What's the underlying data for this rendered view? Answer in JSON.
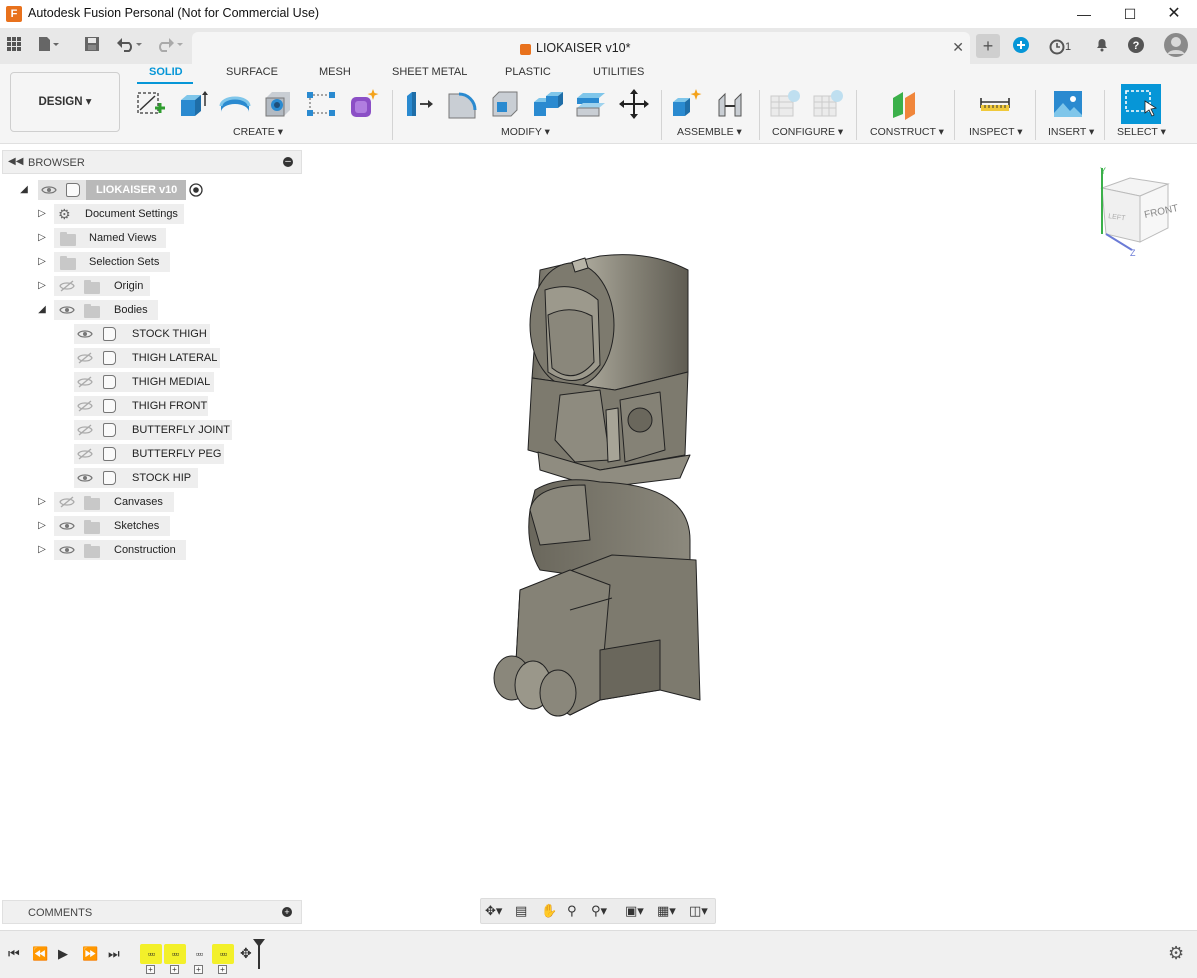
{
  "window": {
    "title": "Autodesk Fusion Personal (Not for Commercial Use)",
    "app_icon_letter": "F",
    "controls": [
      "minimize-icon",
      "maximize-icon",
      "close-icon"
    ]
  },
  "tabbar": {
    "document_tab": "LIOKAISER v10*",
    "job_count": "1"
  },
  "ribbon": {
    "workspace": "DESIGN",
    "tabs": [
      "SOLID",
      "SURFACE",
      "MESH",
      "SHEET METAL",
      "PLASTIC",
      "UTILITIES"
    ],
    "active_tab": "SOLID",
    "groups": [
      "CREATE",
      "MODIFY",
      "ASSEMBLE",
      "CONFIGURE",
      "CONSTRUCT",
      "INSPECT",
      "INSERT",
      "SELECT"
    ]
  },
  "browser": {
    "title": "BROWSER",
    "root": "LIOKAISER v10",
    "items": [
      {
        "label": "Document Settings"
      },
      {
        "label": "Named Views"
      },
      {
        "label": "Selection Sets"
      },
      {
        "label": "Origin"
      },
      {
        "label": "Bodies"
      },
      {
        "label": "Canvases"
      },
      {
        "label": "Sketches"
      },
      {
        "label": "Construction"
      }
    ],
    "bodies": [
      {
        "label": "STOCK THIGH",
        "visible": true
      },
      {
        "label": "THIGH LATERAL",
        "visible": false
      },
      {
        "label": "THIGH MEDIAL",
        "visible": false
      },
      {
        "label": "THIGH FRONT",
        "visible": false
      },
      {
        "label": "BUTTERFLY JOINT",
        "visible": false
      },
      {
        "label": "BUTTERFLY PEG",
        "visible": false
      },
      {
        "label": "STOCK HIP",
        "visible": true
      }
    ]
  },
  "viewcube": {
    "face_front": "FRONT",
    "face_left": "LEFT",
    "axis_y": "Y",
    "axis_z": "Z"
  },
  "comments": {
    "title": "COMMENTS"
  },
  "colors": {
    "accent": "#0696d7",
    "orange": "#e8711c",
    "timeline_highlight": "#f3f02a",
    "model_gray": "#7d7a6e"
  }
}
